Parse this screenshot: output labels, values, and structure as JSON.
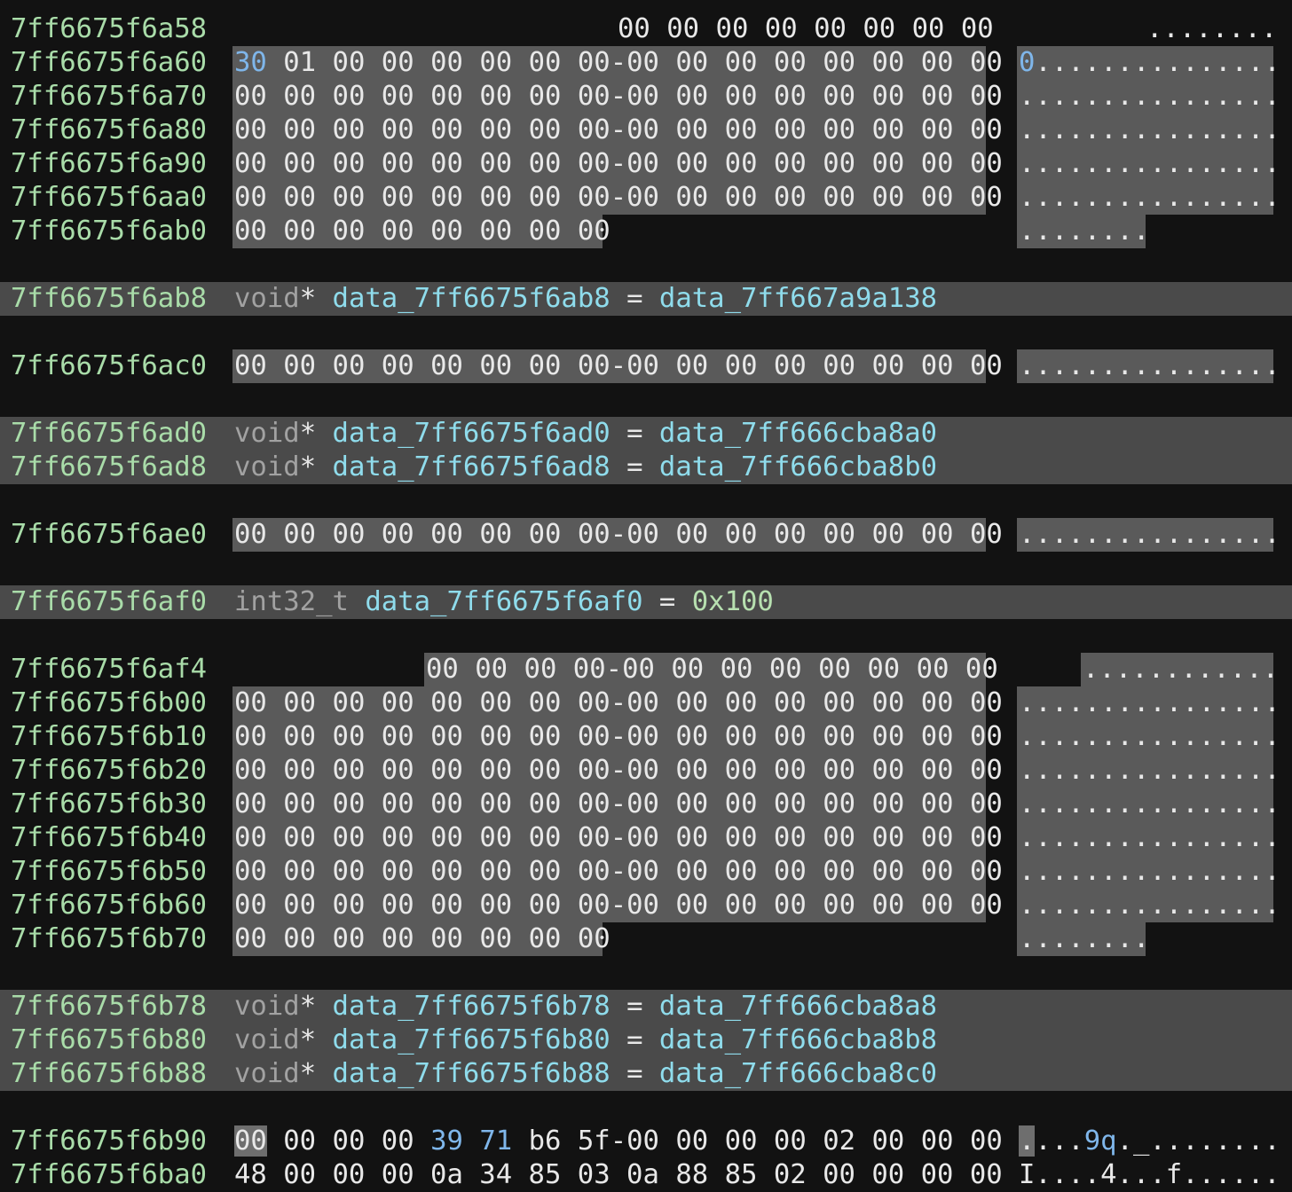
{
  "hex_rows": [
    {
      "addr": "7ff6675f6a58",
      "first_col": 8,
      "bytes": [
        "00",
        "00",
        "00",
        "00",
        "00",
        "00",
        "00",
        "00"
      ],
      "ascii": "........"
    },
    {
      "addr": "7ff6675f6a60",
      "first_col": 0,
      "bytes": [
        "30",
        "01",
        "00",
        "00",
        "00",
        "00",
        "00",
        "00",
        "00",
        "00",
        "00",
        "00",
        "00",
        "00",
        "00",
        "00"
      ],
      "ascii": "0..............."
    },
    {
      "addr": "7ff6675f6a70",
      "first_col": 0,
      "bytes": [
        "00",
        "00",
        "00",
        "00",
        "00",
        "00",
        "00",
        "00",
        "00",
        "00",
        "00",
        "00",
        "00",
        "00",
        "00",
        "00"
      ],
      "ascii": "................"
    },
    {
      "addr": "7ff6675f6a80",
      "first_col": 0,
      "bytes": [
        "00",
        "00",
        "00",
        "00",
        "00",
        "00",
        "00",
        "00",
        "00",
        "00",
        "00",
        "00",
        "00",
        "00",
        "00",
        "00"
      ],
      "ascii": "................"
    },
    {
      "addr": "7ff6675f6a90",
      "first_col": 0,
      "bytes": [
        "00",
        "00",
        "00",
        "00",
        "00",
        "00",
        "00",
        "00",
        "00",
        "00",
        "00",
        "00",
        "00",
        "00",
        "00",
        "00"
      ],
      "ascii": "................"
    },
    {
      "addr": "7ff6675f6aa0",
      "first_col": 0,
      "bytes": [
        "00",
        "00",
        "00",
        "00",
        "00",
        "00",
        "00",
        "00",
        "00",
        "00",
        "00",
        "00",
        "00",
        "00",
        "00",
        "00"
      ],
      "ascii": "................"
    },
    {
      "addr": "7ff6675f6ab0",
      "first_col": 0,
      "bytes": [
        "00",
        "00",
        "00",
        "00",
        "00",
        "00",
        "00",
        "00"
      ],
      "ascii": "........"
    },
    {
      "addr": "7ff6675f6ac0",
      "first_col": 0,
      "bytes": [
        "00",
        "00",
        "00",
        "00",
        "00",
        "00",
        "00",
        "00",
        "00",
        "00",
        "00",
        "00",
        "00",
        "00",
        "00",
        "00"
      ],
      "ascii": "................"
    },
    {
      "addr": "7ff6675f6ae0",
      "first_col": 0,
      "bytes": [
        "00",
        "00",
        "00",
        "00",
        "00",
        "00",
        "00",
        "00",
        "00",
        "00",
        "00",
        "00",
        "00",
        "00",
        "00",
        "00"
      ],
      "ascii": "................"
    },
    {
      "addr": "7ff6675f6af4",
      "first_col": 4,
      "bytes": [
        "00",
        "00",
        "00",
        "00",
        "00",
        "00",
        "00",
        "00",
        "00",
        "00",
        "00",
        "00"
      ],
      "ascii": "............"
    },
    {
      "addr": "7ff6675f6b00",
      "first_col": 0,
      "bytes": [
        "00",
        "00",
        "00",
        "00",
        "00",
        "00",
        "00",
        "00",
        "00",
        "00",
        "00",
        "00",
        "00",
        "00",
        "00",
        "00"
      ],
      "ascii": "................"
    },
    {
      "addr": "7ff6675f6b10",
      "first_col": 0,
      "bytes": [
        "00",
        "00",
        "00",
        "00",
        "00",
        "00",
        "00",
        "00",
        "00",
        "00",
        "00",
        "00",
        "00",
        "00",
        "00",
        "00"
      ],
      "ascii": "................"
    },
    {
      "addr": "7ff6675f6b20",
      "first_col": 0,
      "bytes": [
        "00",
        "00",
        "00",
        "00",
        "00",
        "00",
        "00",
        "00",
        "00",
        "00",
        "00",
        "00",
        "00",
        "00",
        "00",
        "00"
      ],
      "ascii": "................"
    },
    {
      "addr": "7ff6675f6b30",
      "first_col": 0,
      "bytes": [
        "00",
        "00",
        "00",
        "00",
        "00",
        "00",
        "00",
        "00",
        "00",
        "00",
        "00",
        "00",
        "00",
        "00",
        "00",
        "00"
      ],
      "ascii": "................"
    },
    {
      "addr": "7ff6675f6b40",
      "first_col": 0,
      "bytes": [
        "00",
        "00",
        "00",
        "00",
        "00",
        "00",
        "00",
        "00",
        "00",
        "00",
        "00",
        "00",
        "00",
        "00",
        "00",
        "00"
      ],
      "ascii": "................"
    },
    {
      "addr": "7ff6675f6b50",
      "first_col": 0,
      "bytes": [
        "00",
        "00",
        "00",
        "00",
        "00",
        "00",
        "00",
        "00",
        "00",
        "00",
        "00",
        "00",
        "00",
        "00",
        "00",
        "00"
      ],
      "ascii": "................"
    },
    {
      "addr": "7ff6675f6b60",
      "first_col": 0,
      "bytes": [
        "00",
        "00",
        "00",
        "00",
        "00",
        "00",
        "00",
        "00",
        "00",
        "00",
        "00",
        "00",
        "00",
        "00",
        "00",
        "00"
      ],
      "ascii": "................"
    },
    {
      "addr": "7ff6675f6b70",
      "first_col": 0,
      "bytes": [
        "00",
        "00",
        "00",
        "00",
        "00",
        "00",
        "00",
        "00"
      ],
      "ascii": "........"
    },
    {
      "addr": "7ff6675f6b90",
      "first_col": 0,
      "bytes": [
        "00",
        "00",
        "00",
        "00",
        "39",
        "71",
        "b6",
        "5f",
        "00",
        "00",
        "00",
        "00",
        "02",
        "00",
        "00",
        "00"
      ],
      "ascii": "....9q._........"
    }
  ],
  "declarations": [
    {
      "addr": "7ff6675f6ab8",
      "type": "void",
      "star": "*",
      "name": "data_7ff6675f6ab8",
      "eq": "=",
      "value": "data_7ff667a9a138"
    },
    {
      "addr": "7ff6675f6ad0",
      "type": "void",
      "star": "*",
      "name": "data_7ff6675f6ad0",
      "eq": "=",
      "value": "data_7ff666cba8a0"
    },
    {
      "addr": "7ff6675f6ad8",
      "type": "void",
      "star": "*",
      "name": "data_7ff6675f6ad8",
      "eq": "=",
      "value": "data_7ff666cba8b0"
    },
    {
      "addr": "7ff6675f6af0",
      "type": "int32_t",
      "star": "",
      "name": "data_7ff6675f6af0",
      "eq": "=",
      "value": "0x100"
    },
    {
      "addr": "7ff6675f6b78",
      "type": "void",
      "star": "*",
      "name": "data_7ff6675f6b78",
      "eq": "=",
      "value": "data_7ff666cba8a8"
    },
    {
      "addr": "7ff6675f6b80",
      "type": "void",
      "star": "*",
      "name": "data_7ff6675f6b80",
      "eq": "=",
      "value": "data_7ff666cba8b8"
    },
    {
      "addr": "7ff6675f6b88",
      "type": "void",
      "star": "*",
      "name": "data_7ff6675f6b88",
      "eq": "=",
      "value": "data_7ff666cba8c0"
    }
  ],
  "partial_row": {
    "addr": "7ff6675f6ba0",
    "hex": "48 00 00 00 0a 34 85 03 0a 88 85 02 00 00 00 00",
    "ascii": "I....4...f......"
  },
  "colors": {
    "address": "#a9dca9",
    "highlight": "#5a5a5a",
    "declaration_bar": "#4a4a4a",
    "identifier": "#8fdcec",
    "type": "#a2a2a2",
    "printable_byte": "#7fb6ea"
  }
}
